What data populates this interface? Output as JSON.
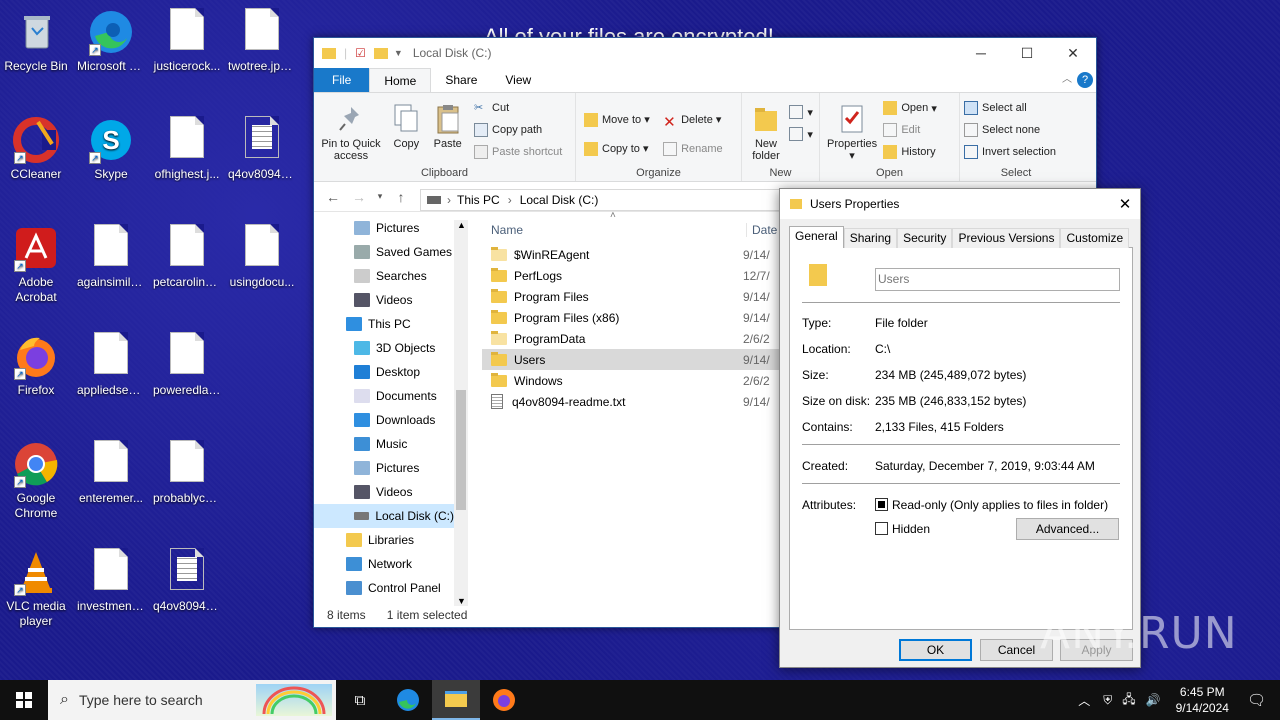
{
  "desktop": {
    "ransom_text": "All of your files are encrypted!",
    "icons": [
      {
        "label": "Recycle Bin"
      },
      {
        "label": "Microsoft Edge"
      },
      {
        "label": "justicerock..."
      },
      {
        "label": "twotree.jpg..."
      },
      {
        "label": "CCleaner"
      },
      {
        "label": "Skype"
      },
      {
        "label": "ofhighest.j..."
      },
      {
        "label": "q4ov8094-r..."
      },
      {
        "label": "Adobe Acrobat"
      },
      {
        "label": "againsimila..."
      },
      {
        "label": "petcarolina..."
      },
      {
        "label": "usingdocu..."
      },
      {
        "label": "Firefox"
      },
      {
        "label": "appliedsee...."
      },
      {
        "label": "poweredlan..."
      },
      {
        "label": "Google Chrome"
      },
      {
        "label": "enteremer..."
      },
      {
        "label": "probablyco..."
      },
      {
        "label": "VLC media player"
      },
      {
        "label": "investment..."
      },
      {
        "label": "q4ov8094-r..."
      }
    ]
  },
  "explorer": {
    "title": "Local Disk (C:)",
    "tabs": {
      "file": "File",
      "home": "Home",
      "share": "Share",
      "view": "View"
    },
    "ribbon": {
      "clipboard": {
        "label": "Clipboard",
        "pin": "Pin to Quick access",
        "copy": "Copy",
        "paste": "Paste",
        "cut": "Cut",
        "copy_path": "Copy path",
        "paste_shortcut": "Paste shortcut"
      },
      "organize": {
        "label": "Organize",
        "move_to": "Move to",
        "copy_to": "Copy to",
        "delete": "Delete",
        "rename": "Rename"
      },
      "new": {
        "label": "New",
        "new_folder": "New folder"
      },
      "open": {
        "label": "Open",
        "properties": "Properties",
        "open": "Open",
        "edit": "Edit",
        "history": "History"
      },
      "select": {
        "label": "Select",
        "select_all": "Select all",
        "select_none": "Select none",
        "invert": "Invert selection"
      }
    },
    "breadcrumb": {
      "this_pc": "This PC",
      "local_disk": "Local Disk (C:)"
    },
    "nav": [
      "Pictures",
      "Saved Games",
      "Searches",
      "Videos",
      "This PC",
      "3D Objects",
      "Desktop",
      "Documents",
      "Downloads",
      "Music",
      "Pictures",
      "Videos",
      "Local Disk (C:)",
      "Libraries",
      "Network",
      "Control Panel"
    ],
    "columns": {
      "name": "Name",
      "date": "Date"
    },
    "files": [
      {
        "name": "$WinREAgent",
        "date": "9/14/"
      },
      {
        "name": "PerfLogs",
        "date": "12/7/"
      },
      {
        "name": "Program Files",
        "date": "9/14/"
      },
      {
        "name": "Program Files (x86)",
        "date": "9/14/"
      },
      {
        "name": "ProgramData",
        "date": "2/6/2"
      },
      {
        "name": "Users",
        "date": "9/14/"
      },
      {
        "name": "Windows",
        "date": "2/6/2"
      },
      {
        "name": "q4ov8094-readme.txt",
        "date": "9/14/"
      }
    ],
    "status": {
      "items": "8 items",
      "selected": "1 item selected"
    }
  },
  "properties": {
    "title": "Users Properties",
    "tabs": [
      "General",
      "Sharing",
      "Security",
      "Previous Versions",
      "Customize"
    ],
    "name_value": "Users",
    "rows": {
      "type_l": "Type:",
      "type_v": "File folder",
      "loc_l": "Location:",
      "loc_v": "C:\\",
      "size_l": "Size:",
      "size_v": "234 MB (245,489,072 bytes)",
      "disk_l": "Size on disk:",
      "disk_v": "235 MB (246,833,152 bytes)",
      "cont_l": "Contains:",
      "cont_v": "2,133 Files, 415 Folders",
      "created_l": "Created:",
      "created_v": "Saturday, December 7, 2019, 9:03:44 AM",
      "attr_l": "Attributes:",
      "readonly": "Read-only (Only applies to files in folder)",
      "hidden": "Hidden"
    },
    "advanced": "Advanced...",
    "ok": "OK",
    "cancel": "Cancel",
    "apply": "Apply"
  },
  "taskbar": {
    "search_placeholder": "Type here to search",
    "time": "6:45 PM",
    "date": "9/14/2024"
  },
  "watermark": "ANY.RUN"
}
